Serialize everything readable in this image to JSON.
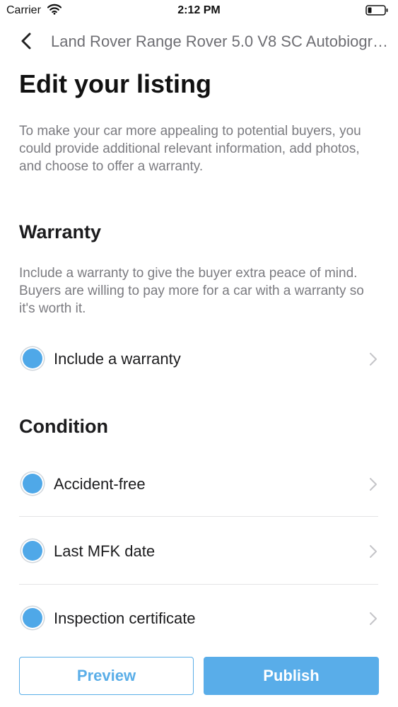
{
  "status_bar": {
    "carrier": "Carrier",
    "time": "2:12 PM",
    "icons": [
      "wifi-icon",
      "battery-icon"
    ]
  },
  "nav": {
    "back_icon": "chevron-left-icon",
    "title": "Land Rover Range Rover 5.0 V8 SC Autobiography"
  },
  "page": {
    "title": "Edit your listing",
    "intro": "To make your car more appealing to potential buyers, you could provide additional relevant information, add photos, and choose to offer a warranty."
  },
  "warranty": {
    "heading": "Warranty",
    "description": "Include a warranty to give the buyer extra peace of mind. Buyers are willing to pay more for a car with a warranty so it's worth it.",
    "item": {
      "label": "Include a warranty",
      "icon": "chevron-right-icon"
    }
  },
  "condition": {
    "heading": "Condition",
    "items": [
      {
        "label": "Accident-free",
        "icon": "chevron-right-icon"
      },
      {
        "label": "Last MFK date",
        "icon": "chevron-right-icon"
      },
      {
        "label": "Inspection certificate",
        "icon": "chevron-right-icon"
      }
    ]
  },
  "actions": {
    "preview_label": "Preview",
    "publish_label": "Publish"
  },
  "colors": {
    "accent": "#59ade9",
    "dot": "#4fa8e8",
    "muted_text": "#7b7b80"
  }
}
